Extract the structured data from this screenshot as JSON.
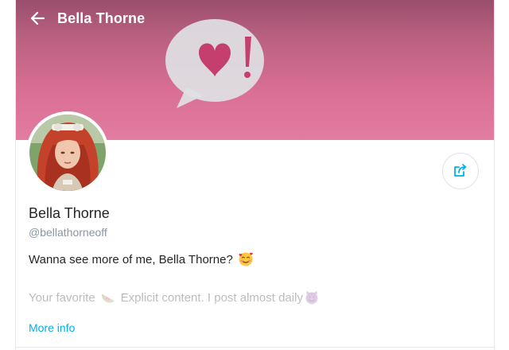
{
  "header": {
    "title": "Bella Thorne",
    "back_icon": "arrow-left-icon"
  },
  "banner": {
    "gradient_top": "#9a4d6c",
    "gradient_bottom": "#e27ca0",
    "art_icon": "speech-bubble-heart-icon"
  },
  "profile": {
    "name": "Bella Thorne",
    "handle": "@bellathorneoff",
    "avatar_icon": "profile-avatar",
    "bio_line1": "Wanna see more of me, Bella Thorne?",
    "bio_line1_emoji": "smiling-face-with-hearts-icon",
    "bio_line2_a": "Your favorite",
    "bio_line2_emoji_a": "watermelon-icon",
    "bio_line2_b": "Explicit content. I post almost daily",
    "bio_line2_emoji_b": "smiling-devil-icon",
    "more_info": "More info",
    "share_icon": "share-icon"
  },
  "colors": {
    "accent": "#00aff0",
    "text": "#242529",
    "muted": "#8a96a3"
  }
}
